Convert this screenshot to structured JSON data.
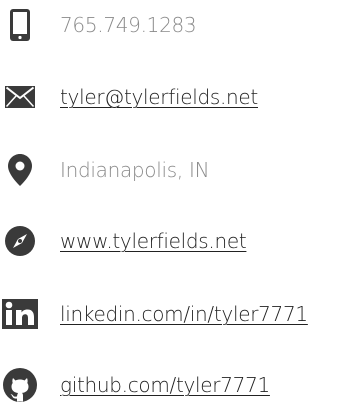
{
  "contacts": {
    "phone": {
      "text": "765.749.1283",
      "icon": "phone-icon"
    },
    "email": {
      "text": "tyler@tylerfields.net",
      "icon": "envelope-icon"
    },
    "location": {
      "text": "Indianapolis, IN",
      "icon": "map-pin-icon"
    },
    "website": {
      "text": "www.tylerfields.net",
      "icon": "compass-icon"
    },
    "linkedin": {
      "text": "linkedin.com/in/tyler7771",
      "icon": "linkedin-icon"
    },
    "github": {
      "text": "github.com/tyler7771",
      "icon": "github-icon"
    }
  },
  "colors": {
    "icon": "#3a3a3a",
    "plain_text": "#8a8a8a",
    "link_text": "#222222"
  }
}
